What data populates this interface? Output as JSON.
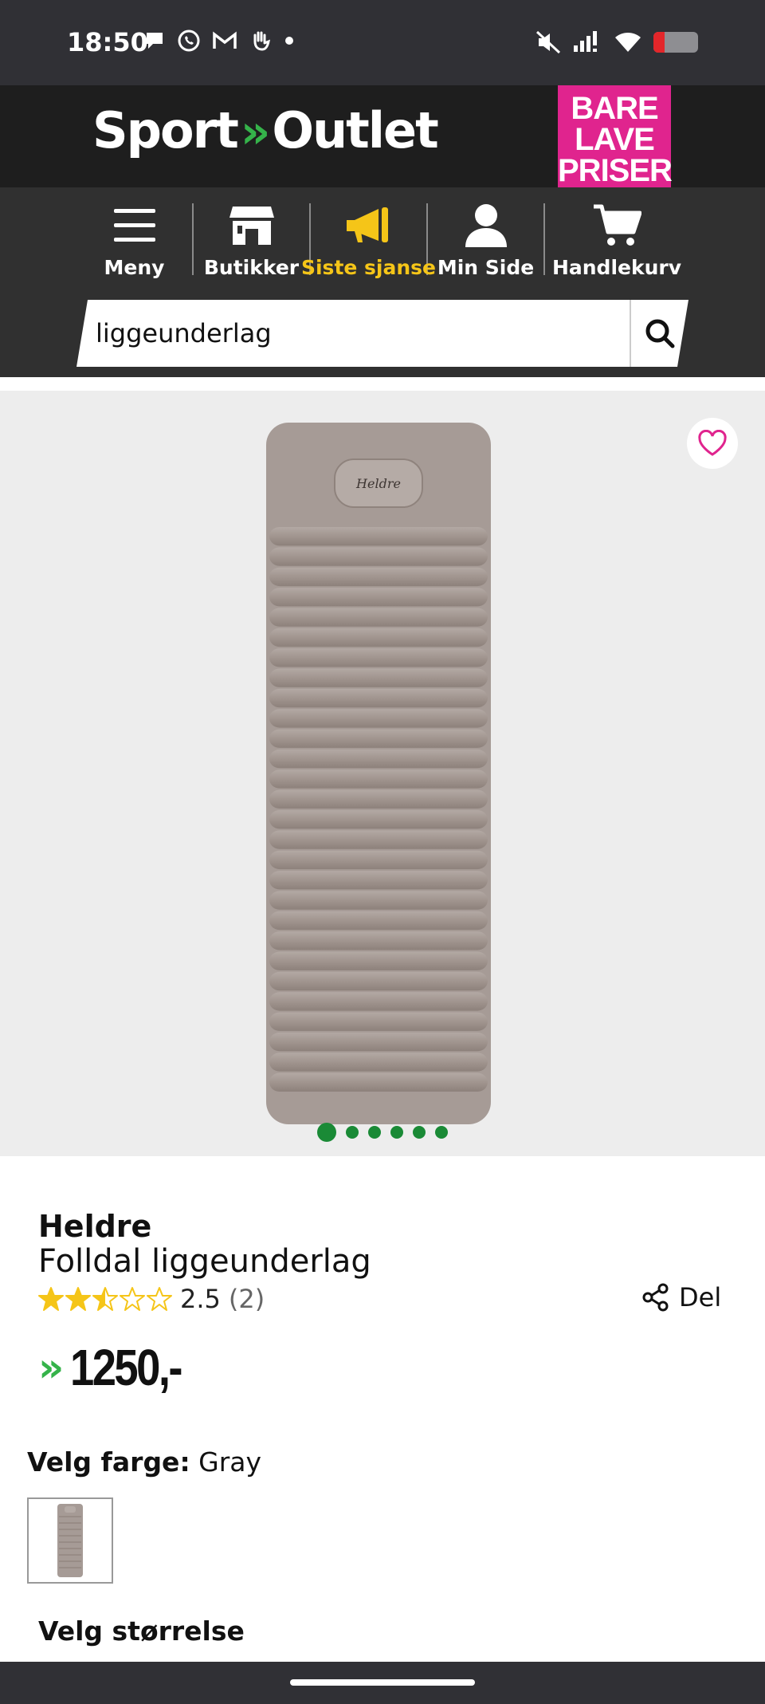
{
  "status_bar": {
    "time": "18:50",
    "icons_left": [
      "chat-bubble-icon",
      "whatsapp-icon",
      "gmail-icon",
      "hand-icon",
      "dot-icon"
    ],
    "icons_right": [
      "mute-icon",
      "signal-icon",
      "wifi-icon",
      "battery-icon"
    ],
    "battery_level": 0.25
  },
  "header": {
    "logo": {
      "left": "Sport",
      "chevron": "»",
      "right": "Outlet"
    },
    "promo": [
      "BARE",
      "LAVE",
      "PRISER"
    ]
  },
  "nav": {
    "items": [
      {
        "label": "Meny",
        "icon": "hamburger-icon"
      },
      {
        "label": "Butikker",
        "icon": "store-icon"
      },
      {
        "label": "Siste sjanse",
        "icon": "megaphone-icon",
        "active": true
      },
      {
        "label": "Min Side",
        "icon": "user-icon"
      },
      {
        "label": "Handlekurv",
        "icon": "cart-icon"
      }
    ]
  },
  "search": {
    "value": "liggeunderlag",
    "placeholder": ""
  },
  "gallery": {
    "image_count": 6,
    "active_index": 0,
    "mat_brand_mark": "Heldre"
  },
  "product": {
    "brand": "Heldre",
    "name": "Folldal liggeunderlag",
    "rating": 2.5,
    "rating_text": "2.5",
    "review_count_text": "(2)",
    "share_label": "Del",
    "price_chevron": "»",
    "price": "1250,-"
  },
  "options": {
    "color_label": "Velg farge:",
    "color_value": "Gray",
    "size_label": "Velg størrelse"
  },
  "colors": {
    "accent_green": "#35b34a",
    "promo_pink": "#e0248e",
    "active_yellow": "#f5c518",
    "dark_bg": "#303030",
    "star": "#f5c518",
    "dot_green": "#1a8a36",
    "mat": "#a39893"
  }
}
